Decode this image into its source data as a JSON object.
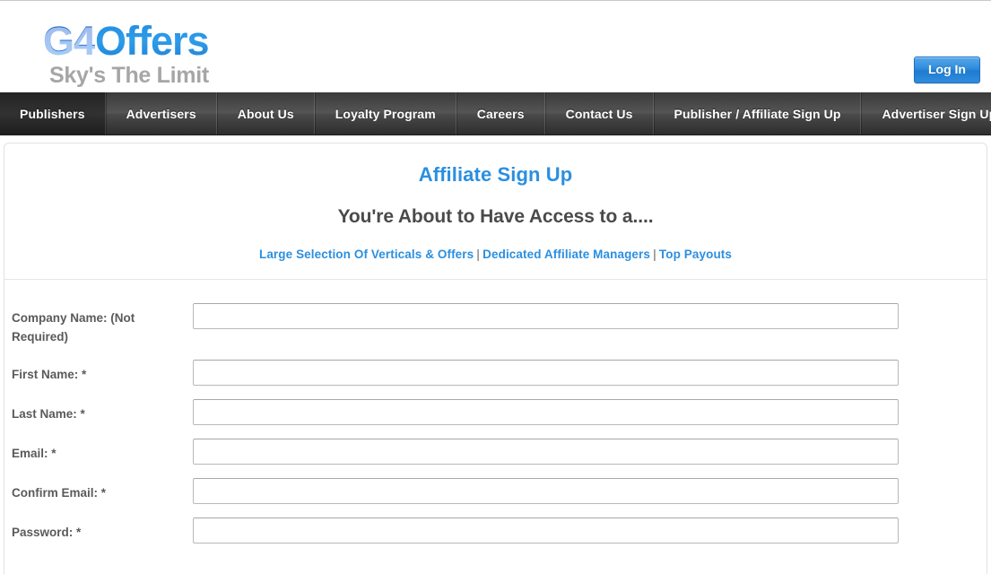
{
  "header": {
    "logo": {
      "part1": "G4",
      "part2": "Offers",
      "tagline": "Sky's The Limit",
      "color_part1": "#0b4fc4",
      "color_part2": "#2f9ce9",
      "color_tagline": "#a6a6a6"
    },
    "login_button": "Log In"
  },
  "nav": {
    "items": [
      {
        "label": "Publishers",
        "active": true
      },
      {
        "label": "Advertisers",
        "active": false
      },
      {
        "label": "About Us",
        "active": false
      },
      {
        "label": "Loyalty Program",
        "active": false
      },
      {
        "label": "Careers",
        "active": false
      },
      {
        "label": "Contact Us",
        "active": false
      },
      {
        "label": "Publisher / Affiliate Sign Up",
        "active": false
      },
      {
        "label": "Advertiser Sign Up",
        "active": false
      }
    ]
  },
  "content": {
    "title": "Affiliate Sign Up",
    "subtitle": "You're About to Have Access to a....",
    "benefits": [
      "Large Selection Of Verticals & Offers",
      "Dedicated Affiliate Managers",
      "Top Payouts"
    ],
    "benefit_separator": "|",
    "accent_color": "#2b8fe0"
  },
  "form": {
    "fields": [
      {
        "label": "Company Name: (Not Required)",
        "value": "",
        "placeholder": ""
      },
      {
        "label": "First Name: *",
        "value": "",
        "placeholder": ""
      },
      {
        "label": "Last Name: *",
        "value": "",
        "placeholder": ""
      },
      {
        "label": "Email: *",
        "value": "",
        "placeholder": ""
      },
      {
        "label": "Confirm Email: *",
        "value": "",
        "placeholder": ""
      },
      {
        "label": "Password: *",
        "value": "",
        "placeholder": ""
      }
    ]
  }
}
